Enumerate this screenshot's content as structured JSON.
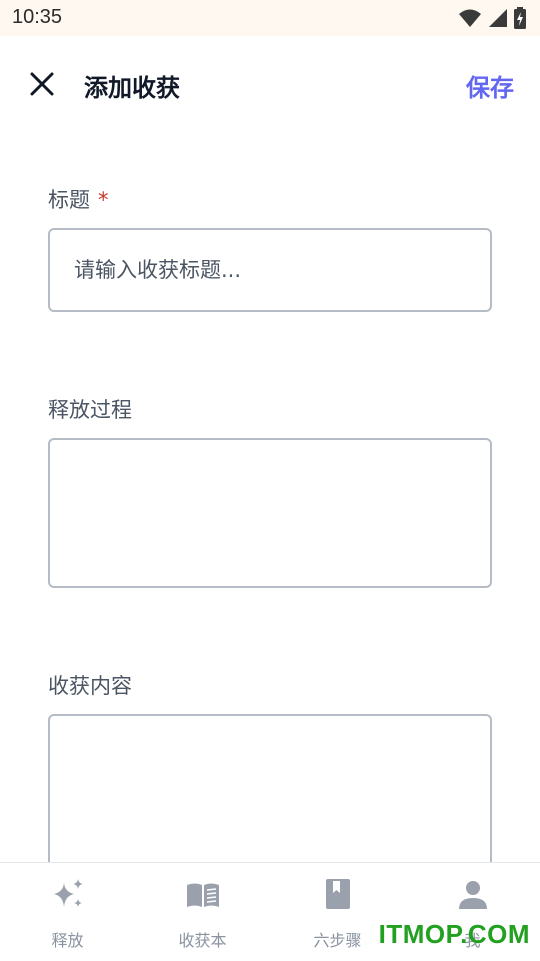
{
  "status_bar": {
    "time": "10:35"
  },
  "header": {
    "title": "添加收获",
    "save_label": "保存"
  },
  "form": {
    "title_field": {
      "label": "标题",
      "required_mark": "*",
      "placeholder": "请输入收获标题...",
      "value": ""
    },
    "process_field": {
      "label": "释放过程",
      "value": ""
    },
    "content_field": {
      "label": "收获内容",
      "value": ""
    }
  },
  "bottom_nav": {
    "items": [
      {
        "label": "释放",
        "icon": "sparkle-icon"
      },
      {
        "label": "收获本",
        "icon": "book-icon"
      },
      {
        "label": "六步骤",
        "icon": "bookmark-book-icon"
      },
      {
        "label": "我",
        "icon": "person-icon"
      }
    ]
  },
  "watermark": "ITMOP.COM",
  "colors": {
    "accent": "#6366f1",
    "required": "#c0392b",
    "nav_inactive": "#8b93a1",
    "status_bg": "#fff8f0"
  }
}
